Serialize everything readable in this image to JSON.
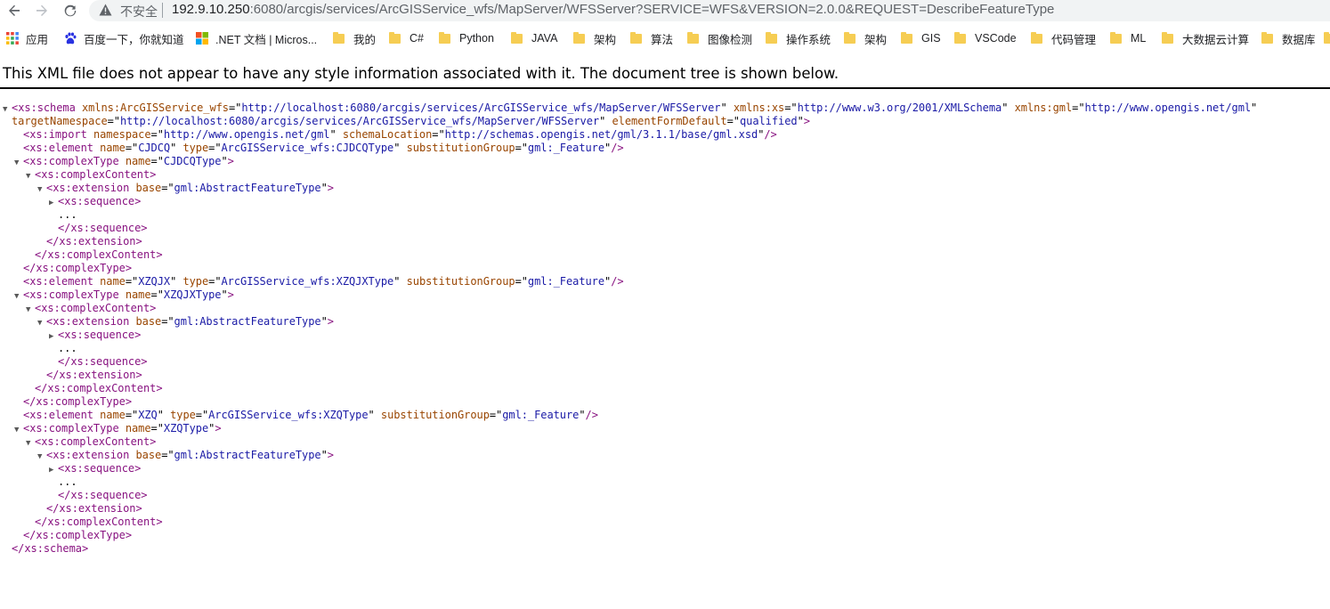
{
  "browser": {
    "security_label": "不安全",
    "url_host": "192.9.10.250",
    "url_rest": ":6080/arcgis/services/ArcGISService_wfs/MapServer/WFSServer?SERVICE=WFS&VERSION=2.0.0&REQUEST=DescribeFeatureType"
  },
  "bookmarks": {
    "apps": "应用",
    "items": [
      "百度一下，你就知道",
      ".NET 文档 | Micros...",
      "我的",
      "C#",
      "Python",
      "JAVA",
      "架构",
      "算法",
      "图像检测",
      "操作系统",
      "架构",
      "GIS",
      "VSCode",
      "代码管理",
      "ML",
      "大数据云计算",
      "数据库"
    ]
  },
  "notice": "This XML file does not appear to have any style information associated with it. The document tree is shown below.",
  "xml": {
    "schema_tag": "xs:schema",
    "ns_arcgis_attr": "xmlns:ArcGISService_wfs",
    "ns_arcgis_val": "http://localhost:6080/arcgis/services/ArcGISService_wfs/MapServer/WFSServer",
    "ns_xs_attr": "xmlns:xs",
    "ns_xs_val": "http://www.w3.org/2001/XMLSchema",
    "ns_gml_attr": "xmlns:gml",
    "ns_gml_val": "http://www.opengis.net/gml",
    "target_attr": "targetNamespace",
    "target_val": "http://localhost:6080/arcgis/services/ArcGISService_wfs/MapServer/WFSServer",
    "efd_attr": "elementFormDefault",
    "efd_val": "qualified",
    "import_tag": "xs:import",
    "import_ns_attr": "namespace",
    "import_ns_val": "http://www.opengis.net/gml",
    "import_loc_attr": "schemaLocation",
    "import_loc_val": "http://schemas.opengis.net/gml/3.1.1/base/gml.xsd",
    "element_tag": "xs:element",
    "complextype_tag": "xs:complexType",
    "complexcontent_tag": "xs:complexContent",
    "extension_tag": "xs:extension",
    "sequence_tag": "xs:sequence",
    "name_attr": "name",
    "type_attr": "type",
    "subst_attr": "substitutionGroup",
    "subst_val": "gml:_Feature",
    "base_attr": "base",
    "base_val": "gml:AbstractFeatureType",
    "ellipsis": "...",
    "features": [
      {
        "name": "CJDCQ",
        "type": "ArcGISService_wfs:CJDCQType",
        "typename": "CJDCQType"
      },
      {
        "name": "XZQJX",
        "type": "ArcGISService_wfs:XZQJXType",
        "typename": "XZQJXType"
      },
      {
        "name": "XZQ",
        "type": "ArcGISService_wfs:XZQType",
        "typename": "XZQType"
      }
    ]
  }
}
